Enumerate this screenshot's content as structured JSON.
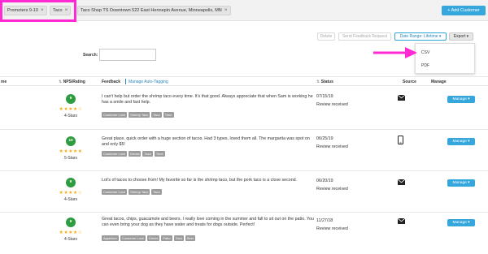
{
  "filters": {
    "chips": [
      "Promoters 9-10",
      "Taco",
      "Taco Shop TS Downtown 522 East Hennepin Avenue, Minneapolis, MN"
    ],
    "close_glyph": "×"
  },
  "header": {
    "add_customer": "+ Add Customer"
  },
  "toolbar": {
    "delete": "Delete",
    "send_feedback": "Send Feedback Request",
    "date_range": "Date Range: Lifetime ▾",
    "export": "Export ▾"
  },
  "export_menu": {
    "items": [
      "CSV",
      "PDF"
    ]
  },
  "search": {
    "label": "Search:",
    "value": ""
  },
  "table": {
    "headers": {
      "name": "me",
      "nps": "NPS/Rating",
      "feedback": "Feedback",
      "auto_tag": "Manage Auto-Tagging",
      "status": "Status",
      "source": "Source",
      "manage": "Manage"
    },
    "sort_glyph": "⇅",
    "rows": [
      {
        "score": "9",
        "stars": "★★★★☆",
        "rating": 4,
        "stars_label": "4-Stars",
        "feedback": "I can't help but order the shrimp taco every time. It's that good. Always appreciate that when Sam is working he has a smile and fast help.",
        "tags": [
          "Customer Love",
          "Shrimp Taco",
          "Taco",
          "Time"
        ],
        "date": "07/15/19",
        "status": "Review received",
        "source": "email",
        "manage": "Manage ▾"
      },
      {
        "score": "10",
        "stars": "★★★★★",
        "rating": 5,
        "stars_label": "5-Stars",
        "feedback": "Great place, quick order with a huge section of tacos. Had 3 types, loved them all. The margarita was spot on and only $5!",
        "tags": [
          "Customer Love",
          "Drinks",
          "Taco",
          "Time"
        ],
        "date": "06/25/19",
        "status": "Review received",
        "source": "phone",
        "manage": "Manage ▾"
      },
      {
        "score": "9",
        "stars": "★★★★☆",
        "rating": 4,
        "stars_label": "4-Stars",
        "feedback": "Lot's of tacos to choose from! My favorite so far is the shrimp taco, but the pork taco is a close second.",
        "tags": [
          "Customer Love",
          "Shrimp Taco",
          "Taco"
        ],
        "date": "06/20/19",
        "status": "Review received",
        "source": "email",
        "manage": "Manage ▾"
      },
      {
        "score": "9",
        "stars": "★★★★☆",
        "rating": 4,
        "stars_label": "4-Stars",
        "feedback": "Great tacos, chips, guacamole and beers. I really love coming in the summer and fall to sit out on the patio. You can even bring your dog as they have water and treats for dogs outside. Perfect!",
        "tags": [
          "Appetizer",
          "Customer Love",
          "Drinks",
          "Patio",
          "Taco",
          "Beer"
        ],
        "date": "11/27/18",
        "status": "Review received",
        "source": "email",
        "manage": "Manage ▾"
      }
    ]
  },
  "colors": {
    "highlight": "#ff2ad4",
    "accent": "#35a7dc",
    "score_green": "#2e9d3f",
    "star": "#f2b01e",
    "tag_gray": "#9c9c9c"
  }
}
